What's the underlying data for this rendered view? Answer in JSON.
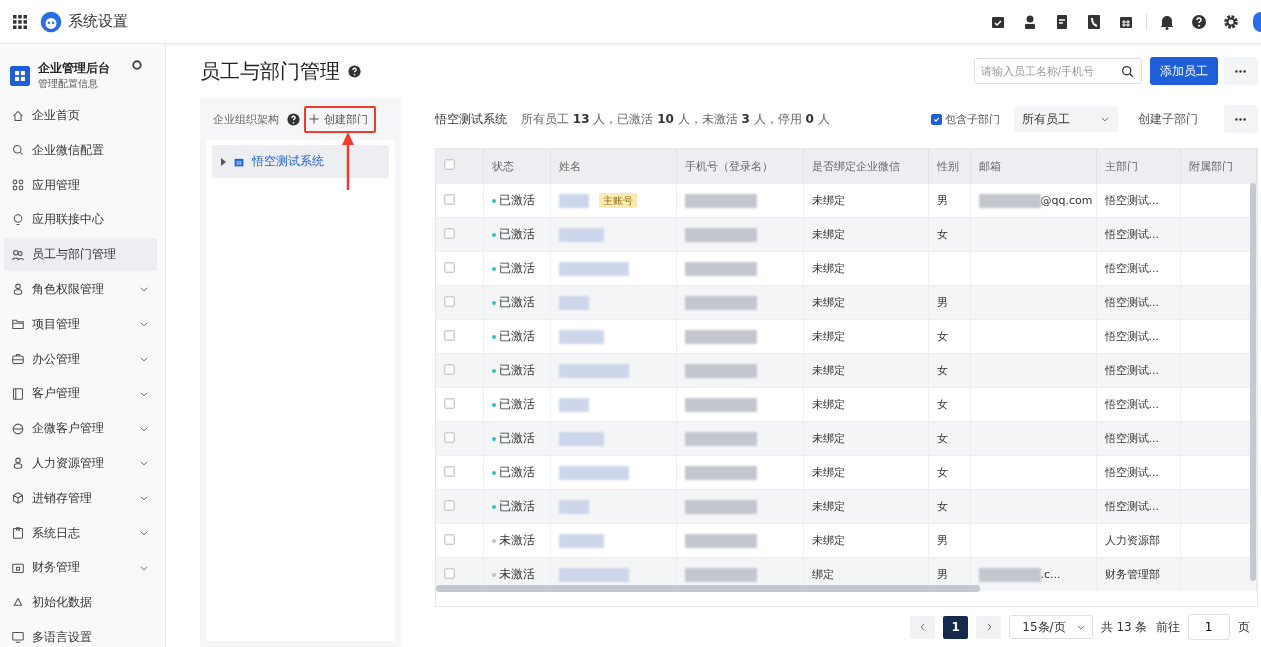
{
  "app_bar": {
    "title": "系统设置"
  },
  "sidebar": {
    "title": "企业管理后台",
    "subtitle": "管理配置信息",
    "items": [
      {
        "label": "企业首页",
        "expandable": false,
        "selected": false
      },
      {
        "label": "企业微信配置",
        "expandable": false,
        "selected": false
      },
      {
        "label": "应用管理",
        "expandable": false,
        "selected": false
      },
      {
        "label": "应用联接中心",
        "expandable": false,
        "selected": false
      },
      {
        "label": "员工与部门管理",
        "expandable": false,
        "selected": true
      },
      {
        "label": "角色权限管理",
        "expandable": true,
        "selected": false
      },
      {
        "label": "项目管理",
        "expandable": true,
        "selected": false
      },
      {
        "label": "办公管理",
        "expandable": true,
        "selected": false
      },
      {
        "label": "客户管理",
        "expandable": true,
        "selected": false
      },
      {
        "label": "企微客户管理",
        "expandable": true,
        "selected": false
      },
      {
        "label": "人力资源管理",
        "expandable": true,
        "selected": false
      },
      {
        "label": "进销存管理",
        "expandable": true,
        "selected": false
      },
      {
        "label": "系统日志",
        "expandable": true,
        "selected": false
      },
      {
        "label": "财务管理",
        "expandable": true,
        "selected": false
      },
      {
        "label": "初始化数据",
        "expandable": false,
        "selected": false
      },
      {
        "label": "多语言设置",
        "expandable": false,
        "selected": false
      }
    ]
  },
  "page": {
    "title": "员工与部门管理",
    "search": {
      "placeholder": "请输入员工名称/手机号"
    },
    "add_button": "添加员工"
  },
  "org_panel": {
    "title": "企业组织架构",
    "create_button": "创建部门",
    "create_highlighted": true,
    "tree": [
      {
        "label": "悟空测试系统",
        "selected": true,
        "expanded": false
      }
    ]
  },
  "staff": {
    "department": "悟空测试系统",
    "summary": "所有员工 **13** 人，已激活 **10** 人，未激活 **3** 人，停用 **0** 人",
    "include_sub": {
      "label": "包含子部门",
      "checked": true
    },
    "filter": "所有员工",
    "create_sub_button": "创建子部门",
    "columns": [
      "状态",
      "姓名",
      "手机号（登录名）",
      "是否绑定企业微信",
      "性别",
      "邮箱",
      "主部门",
      "附属部门"
    ],
    "rows": [
      {
        "checked": false,
        "activated": true,
        "status": "已激活",
        "name_badge": "主账号",
        "wechat": "未绑定",
        "gender": "男",
        "email": "@qq.com",
        "department": "悟空测试..."
      },
      {
        "checked": false,
        "activated": true,
        "status": "已激活",
        "wechat": "未绑定",
        "gender": "女",
        "department": "悟空测试..."
      },
      {
        "checked": false,
        "activated": true,
        "status": "已激活",
        "wechat": "未绑定",
        "department": "悟空测试..."
      },
      {
        "checked": false,
        "activated": true,
        "status": "已激活",
        "wechat": "未绑定",
        "gender": "男",
        "department": "悟空测试..."
      },
      {
        "checked": false,
        "activated": true,
        "status": "已激活",
        "wechat": "未绑定",
        "gender": "女",
        "department": "悟空测试..."
      },
      {
        "checked": false,
        "activated": true,
        "status": "已激活",
        "wechat": "未绑定",
        "gender": "女",
        "department": "悟空测试..."
      },
      {
        "checked": false,
        "activated": true,
        "status": "已激活",
        "wechat": "未绑定",
        "gender": "女",
        "department": "悟空测试..."
      },
      {
        "checked": false,
        "activated": true,
        "status": "已激活",
        "wechat": "未绑定",
        "gender": "女",
        "department": "悟空测试..."
      },
      {
        "checked": false,
        "activated": true,
        "status": "已激活",
        "wechat": "未绑定",
        "gender": "女",
        "department": "悟空测试..."
      },
      {
        "checked": false,
        "activated": true,
        "status": "已激活",
        "wechat": "未绑定",
        "gender": "女",
        "department": "悟空测试..."
      },
      {
        "checked": false,
        "activated": false,
        "status": "未激活",
        "wechat": "未绑定",
        "gender": "男",
        "department": "人力资源部"
      },
      {
        "checked": false,
        "activated": false,
        "status": "未激活",
        "wechat": "绑定",
        "gender": "男",
        "email": ".c...",
        "department": "财务管理部"
      }
    ]
  },
  "pagination": {
    "pages": [
      {
        "label": "1",
        "selected": true
      }
    ],
    "page_size": "15条/页",
    "total": "共 13 条",
    "goto_label": "前往",
    "goto_value": "1",
    "page_unit": "页"
  }
}
